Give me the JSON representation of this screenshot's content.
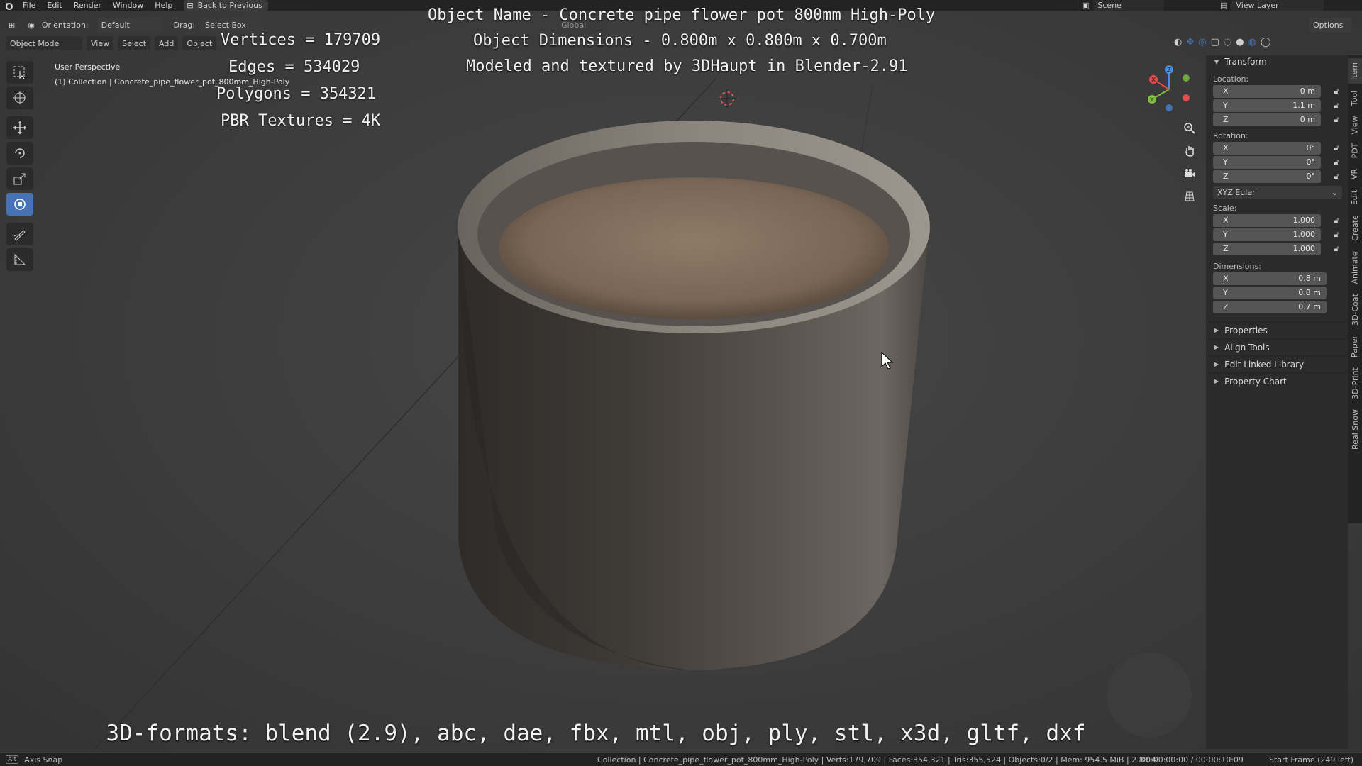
{
  "menu": {
    "items": [
      "File",
      "Edit",
      "Render",
      "Window",
      "Help"
    ],
    "back_label": "Back to Previous",
    "scene_label": "Scene",
    "view_layer_label": "View Layer"
  },
  "header": {
    "orientation_label": "Orientation:",
    "orientation_value": "Default",
    "drag_label": "Drag:",
    "drag_value": "Select Box",
    "transform_orientation": "Global",
    "options_label": "Options",
    "mode": "Object Mode",
    "view": "View",
    "select": "Select",
    "add": "Add",
    "object": "Object"
  },
  "viewport": {
    "perspective": "User Perspective",
    "collection": "(1) Collection | Concrete_pipe_flower_pot_800mm_High-Poly"
  },
  "overlay": {
    "vertices": "Vertices = 179709",
    "edges": "Edges = 534029",
    "polygons": "Polygons = 354321",
    "textures": "PBR Textures = 4K",
    "object_name": "Object Name - Concrete pipe flower pot 800mm High-Poly",
    "dimensions": "Object Dimensions -  0.800m x 0.800m x 0.700m",
    "credit": "Modeled and textured by 3DHaupt in Blender-2.91",
    "formats": "3D-formats: blend (2.9), abc, dae, fbx, mtl, obj, ply, stl, x3d, gltf, dxf"
  },
  "panel": {
    "transform_title": "Transform",
    "location_label": "Location:",
    "location": [
      {
        "axis": "X",
        "value": "0 m"
      },
      {
        "axis": "Y",
        "value": "1.1 m"
      },
      {
        "axis": "Z",
        "value": "0 m"
      }
    ],
    "rotation_label": "Rotation:",
    "rotation": [
      {
        "axis": "X",
        "value": "0°"
      },
      {
        "axis": "Y",
        "value": "0°"
      },
      {
        "axis": "Z",
        "value": "0°"
      }
    ],
    "rotation_mode": "XYZ Euler",
    "scale_label": "Scale:",
    "scale": [
      {
        "axis": "X",
        "value": "1.000"
      },
      {
        "axis": "Y",
        "value": "1.000"
      },
      {
        "axis": "Z",
        "value": "1.000"
      }
    ],
    "dimensions_label": "Dimensions:",
    "dimensions": [
      {
        "axis": "X",
        "value": "0.8 m"
      },
      {
        "axis": "Y",
        "value": "0.8 m"
      },
      {
        "axis": "Z",
        "value": "0.7 m"
      }
    ],
    "subpanels": [
      "Properties",
      "Align Tools",
      "Edit Linked Library",
      "Property Chart"
    ]
  },
  "tabs": [
    "Item",
    "Tool",
    "View",
    "PDT",
    "VR",
    "Edit",
    "Create",
    "Animate",
    "3D-Coat",
    "Paper",
    "3D-Print",
    "Real Snow"
  ],
  "status": {
    "alt_key": "Alt",
    "left": "Axis Snap",
    "middle": "Collection | Concrete_pipe_flower_pot_800mm_High-Poly | Verts:179,709 | Faces:354,321 | Tris:355,524 | Objects:0/2 | Mem: 954.5 MiB | 2.83.4",
    "time": "00:00:00:00 / 00:00:10:09",
    "frame": "Start Frame (249 left)"
  },
  "colors": {
    "accent": "#4772b3",
    "gizmo_x": "#e74c4c",
    "gizmo_y": "#7fbf3f",
    "gizmo_z": "#4a8fe0"
  }
}
